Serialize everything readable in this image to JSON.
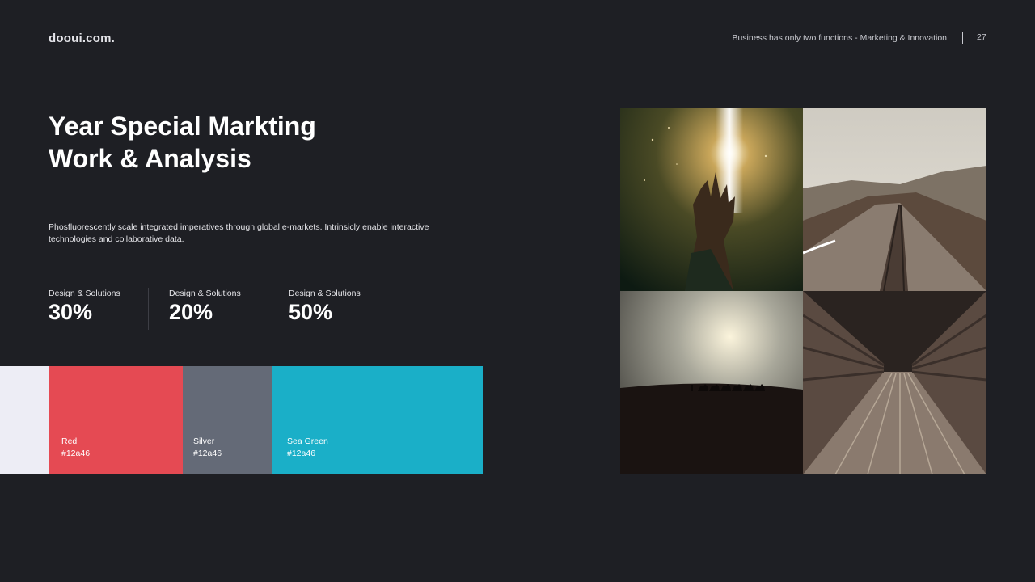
{
  "header": {
    "logo": "dooui.com.",
    "tagline": "Business has only two functions - Marketing & Innovation",
    "page_number": "27"
  },
  "title": {
    "line1": "Year Special Markting",
    "line2": "Work & Analysis"
  },
  "description": "Phosfluorescently scale integrated imperatives through global e-markets. Intrinsicly enable interactive technologies and collaborative data.",
  "stats": [
    {
      "label": "Design & Solutions",
      "value": "30%"
    },
    {
      "label": "Design & Solutions",
      "value": "20%"
    },
    {
      "label": "Design & Solutions",
      "value": "50%"
    }
  ],
  "swatches": [
    {
      "name": "",
      "code": "",
      "color": "#ededf5"
    },
    {
      "name": "Red",
      "code": "#12a46",
      "color": "#e54a53"
    },
    {
      "name": "Silver",
      "code": "#12a46",
      "color": "#646a77"
    },
    {
      "name": "Sea Green",
      "code": "#12a46",
      "color": "#1aafc8"
    }
  ],
  "photos": [
    {
      "subject": "hand reaching toward light"
    },
    {
      "subject": "railway tracks through mountains"
    },
    {
      "subject": "camel caravan silhouette at dusk"
    },
    {
      "subject": "wooden bridge walkway"
    }
  ]
}
